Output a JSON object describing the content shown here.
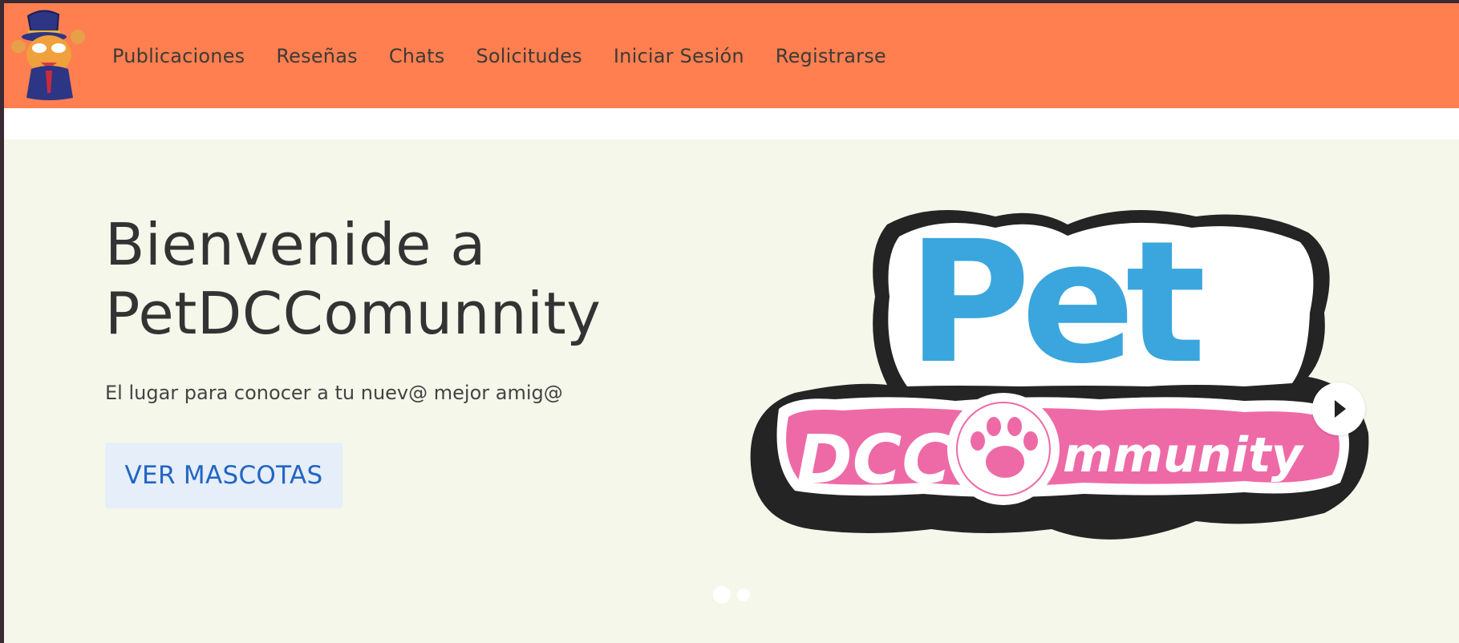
{
  "navbar": {
    "background": "#ff7f50",
    "logo_icon": "wizard-cat-mascot-icon",
    "links": [
      {
        "label": "Publicaciones"
      },
      {
        "label": "Reseñas"
      },
      {
        "label": "Chats"
      },
      {
        "label": "Solicitudes"
      },
      {
        "label": "Iniciar Sesión"
      },
      {
        "label": "Registrarse"
      }
    ]
  },
  "hero": {
    "background": "#f4f7ea",
    "title_line1": "Bienvenide a",
    "title_line2": "PetDCComunnity",
    "subtitle": "El lugar para conocer a tu nuev@ mejor amig@",
    "cta_label": "VER MASCOTAS",
    "carousel": {
      "logo": {
        "word_top": "Pet",
        "word_left": "DCC",
        "word_right": "mmunity",
        "colors": {
          "blue": "#3aa6dd",
          "pink": "#ee6aa7",
          "outline": "#242424"
        }
      },
      "next_icon": "play-arrow-icon",
      "indicators": 2,
      "active_indicator": 1
    }
  }
}
